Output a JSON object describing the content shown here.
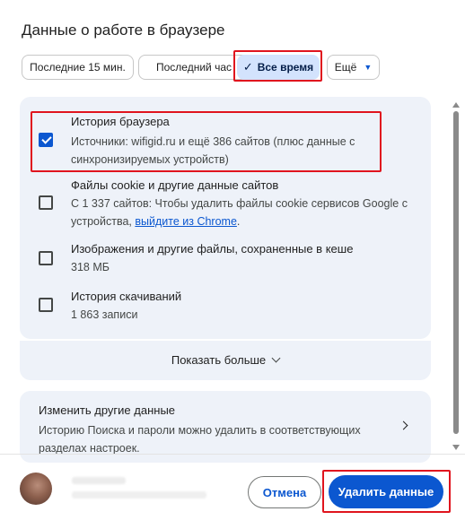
{
  "dialog": {
    "title": "Данные о работе в браузере"
  },
  "time_range": {
    "chips": [
      {
        "label": "Последние 15 мин."
      },
      {
        "label": "Последний час"
      },
      {
        "label": "Все время",
        "selected": true
      },
      {
        "label": "Ещё"
      }
    ],
    "check_glyph": "✓",
    "caret_glyph": "▼"
  },
  "items": [
    {
      "title": "История браузера",
      "subtitle": "Источники: wifigid.ru и ещё 386 сайтов (плюс данные с синхронизируемых устройств)",
      "checked": true
    },
    {
      "title": "Файлы cookie и другие данные сайтов",
      "subtitle_prefix": "С 1 337 сайтов: Чтобы удалить файлы cookie сервисов Google с устройства, ",
      "subtitle_link": "выйдите из Chrome",
      "subtitle_suffix": ".",
      "checked": false
    },
    {
      "title": "Изображения и другие файлы, сохраненные в кеше",
      "subtitle": "318 МБ",
      "checked": false
    },
    {
      "title": "История скачиваний",
      "subtitle": "1 863 записи",
      "checked": false
    }
  ],
  "show_more": {
    "label": "Показать больше",
    "icon": "chevron-down-icon"
  },
  "other_data": {
    "title": "Изменить другие данные",
    "subtitle": "Историю Поиска и пароли можно удалить в соответствующих разделах настроек.",
    "icon": "chevron-right-icon"
  },
  "footer": {
    "cancel_label": "Отмена",
    "delete_label": "Удалить данные"
  },
  "colors": {
    "accent": "#0b57d0",
    "highlight": "#e0141e",
    "card_bg": "#eef2f9",
    "selected_chip_bg": "#d3e3fd"
  }
}
